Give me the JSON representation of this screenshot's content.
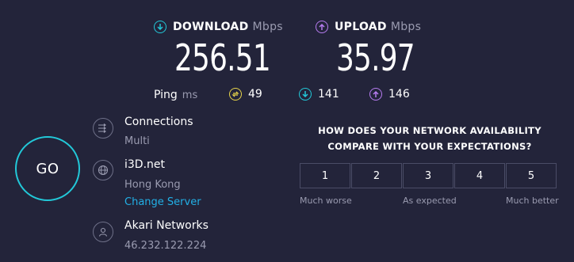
{
  "download": {
    "label": "DOWNLOAD",
    "unit": "Mbps",
    "value": "256.51",
    "icon": "arrow-down-circle-icon",
    "color": "#22c8d8"
  },
  "upload": {
    "label": "UPLOAD",
    "unit": "Mbps",
    "value": "35.97",
    "icon": "arrow-up-circle-icon",
    "color": "#b77cf0"
  },
  "ping": {
    "label": "Ping",
    "unit": "ms",
    "idle": {
      "value": "49",
      "icon": "ping-idle-icon",
      "color": "#e6d34a"
    },
    "download": {
      "value": "141",
      "icon": "ping-download-icon",
      "color": "#22c8d8"
    },
    "upload": {
      "value": "146",
      "icon": "ping-upload-icon",
      "color": "#b77cf0"
    }
  },
  "go_button": {
    "label": "GO"
  },
  "connections": {
    "title": "Connections",
    "value": "Multi",
    "icon": "connections-icon"
  },
  "server": {
    "title": "i3D.net",
    "location": "Hong Kong",
    "change_label": "Change Server",
    "icon": "globe-icon"
  },
  "provider": {
    "title": "Akari Networks",
    "ip": "46.232.122.224",
    "icon": "user-icon"
  },
  "survey": {
    "question_line1": "HOW DOES YOUR NETWORK AVAILABILITY",
    "question_line2": "COMPARE WITH YOUR EXPECTATIONS?",
    "options": [
      "1",
      "2",
      "3",
      "4",
      "5"
    ],
    "label_low": "Much worse",
    "label_mid": "As expected",
    "label_high": "Much better"
  }
}
